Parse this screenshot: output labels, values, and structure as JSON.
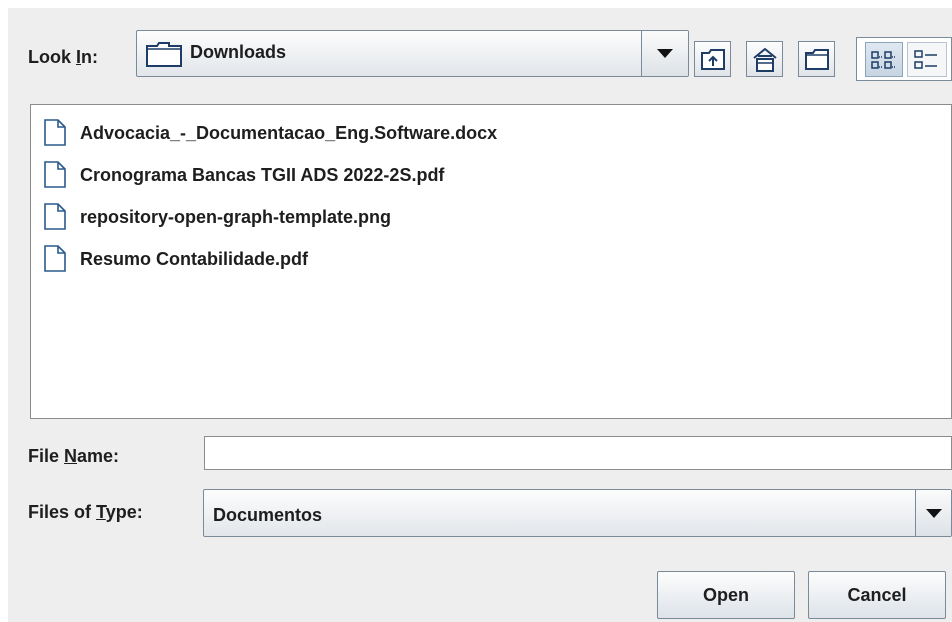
{
  "look_in": {
    "label_pre": "Look ",
    "label_mnemonic": "I",
    "label_post": "n:",
    "value": "Downloads"
  },
  "toolbar": {
    "up_icon": "up-one-level-icon",
    "home_icon": "home-icon",
    "new_folder_icon": "new-folder-icon",
    "details_view_icon": "details-view-icon",
    "list_view_icon": "list-view-icon"
  },
  "files": [
    {
      "name": "Advocacia_-_Documentacao_Eng.Software.docx"
    },
    {
      "name": "Cronograma Bancas TGII ADS 2022-2S.pdf"
    },
    {
      "name": "repository-open-graph-template.png"
    },
    {
      "name": "Resumo Contabilidade.pdf"
    }
  ],
  "file_name": {
    "label_pre": "File ",
    "label_mnemonic": "N",
    "label_post": "ame:",
    "value": ""
  },
  "file_type": {
    "label_pre": "Files of ",
    "label_mnemonic": "T",
    "label_post": "ype:",
    "value": "Documentos"
  },
  "buttons": {
    "open": "Open",
    "cancel": "Cancel"
  },
  "colors": {
    "dialog_bg": "#eeeeee",
    "selected_toggle": "#c7d4e2",
    "border": "#7a8a99"
  }
}
